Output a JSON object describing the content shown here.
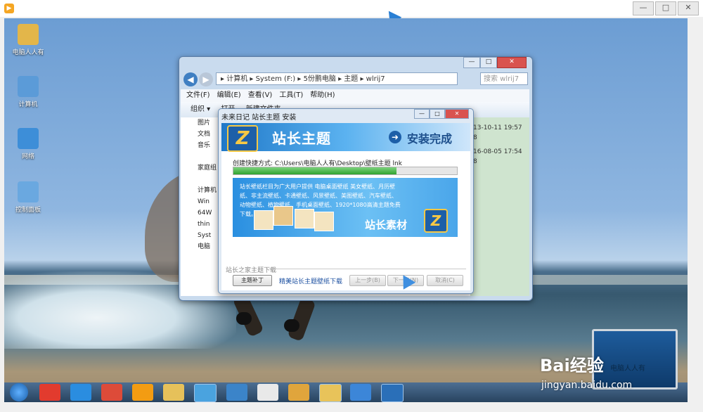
{
  "outer": {
    "app_icon_glyph": "▶",
    "controls": [
      "—",
      "□",
      "✕"
    ]
  },
  "desktop_icons": [
    {
      "label": "电脑人人有",
      "color": "#e3b64a"
    },
    {
      "label": "计算机",
      "color": "#5b9bd8"
    },
    {
      "label": "网络",
      "color": "#3d8ed8"
    },
    {
      "label": "控制面板",
      "color": "#6aa8e0"
    }
  ],
  "explorer": {
    "controls": [
      "—",
      "□",
      "✕"
    ],
    "address": "▸ 计算机 ▸ System (F:) ▸ 5份鹏电脑 ▸ 主题 ▸ wlrij7",
    "search_placeholder": "搜索 wlrij7",
    "menu": [
      "文件(F)",
      "编辑(E)",
      "查看(V)",
      "工具(T)",
      "帮助(H)"
    ],
    "toolbar": {
      "organize": "组织 ▾",
      "open": "打开",
      "new_folder": "新建文件夹"
    },
    "sidebar": [
      "图片",
      "文档",
      "音乐",
      "",
      "家庭组",
      "",
      "计算机",
      "Win",
      "64W",
      "thin",
      "Syst",
      "电脑"
    ],
    "dates": [
      "13-10-11 19:57",
      "8",
      "16-08-05 17:54",
      "8"
    ]
  },
  "installer": {
    "title": "未来日记 站长主题 安装",
    "controls": [
      "—",
      "□",
      "✕"
    ],
    "logo": "Z",
    "brand": "站长主题",
    "done_label": "安装完成",
    "shortcut_text": "创建快捷方式: C:\\Users\\电脑人人有\\Desktop\\壁纸主题 lnk",
    "progress": 0.73,
    "ad_text": "站长壁纸栏目为广大用户提供 电脑桌面壁纸 美女壁纸、月历壁纸、非主流壁纸、卡通壁纸、风景壁纸、美图壁纸、汽车壁纸、动物壁纸、植物壁纸、手机桌面壁纸、1920*1080高清主题免费下载。",
    "ad_brand": "站长素材",
    "footer_label": "站长之家主题下载",
    "patch_button": "主题补丁",
    "link_text": "精美站长主题壁纸下载",
    "prev_button": "上一步(B)",
    "next_button": "下一步(N)",
    "cancel_button": "取消(C)"
  },
  "taskbar_icons": [
    {
      "name": "start",
      "color": "#1a5ea8"
    },
    {
      "name": "jiang",
      "color": "#e23b2e"
    },
    {
      "name": "ie",
      "color": "#2a8de0"
    },
    {
      "name": "chrome",
      "color": "#dd4b39"
    },
    {
      "name": "player",
      "color": "#f39c12"
    },
    {
      "name": "folder",
      "color": "#e6c15a"
    },
    {
      "name": "browser",
      "color": "#4aa3df"
    },
    {
      "name": "display",
      "color": "#3b84c9"
    },
    {
      "name": "flower",
      "color": "#e9e9e9"
    },
    {
      "name": "paint",
      "color": "#e0a53c"
    },
    {
      "name": "explorer",
      "color": "#e8c35a"
    },
    {
      "name": "app",
      "color": "#3c86d8"
    },
    {
      "name": "installer",
      "color": "#2a6fb8"
    }
  ],
  "watermark": {
    "brand": "Bai经验",
    "domain": "jingyan.baidu.com",
    "note": "电脑人人有"
  }
}
